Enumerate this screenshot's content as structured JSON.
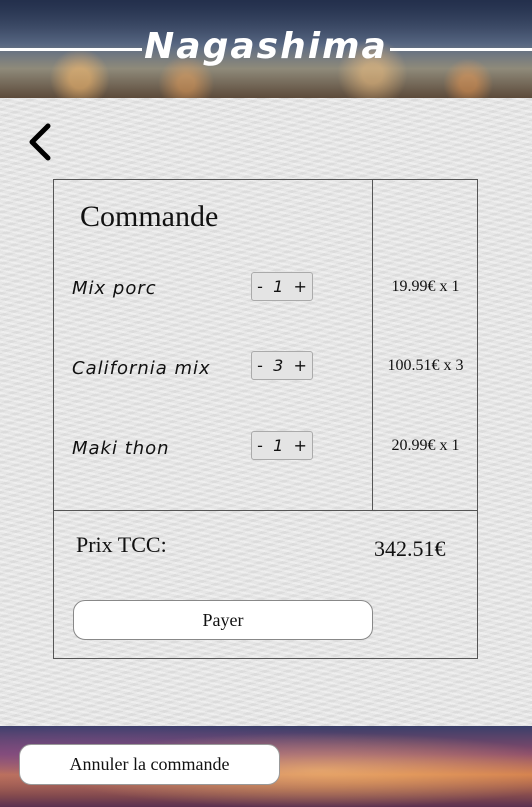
{
  "header": {
    "brand": "Nagashima"
  },
  "order": {
    "title": "Commande",
    "items": [
      {
        "name": "Mix porc",
        "minus": "-",
        "qty": "1",
        "plus": "+",
        "price": "19.99€ x 1"
      },
      {
        "name": "California mix",
        "minus": "-",
        "qty": "3",
        "plus": "+",
        "price": "100.51€ x 3"
      },
      {
        "name": "Maki thon",
        "minus": "-",
        "qty": "1",
        "plus": "+",
        "price": "20.99€ x 1"
      }
    ],
    "total_label": "Prix TCC:",
    "total_value": "342.51€",
    "pay_label": "Payer"
  },
  "footer": {
    "cancel_label": "Annuler la commande"
  },
  "icons": {
    "back": "chevron-left-icon"
  }
}
